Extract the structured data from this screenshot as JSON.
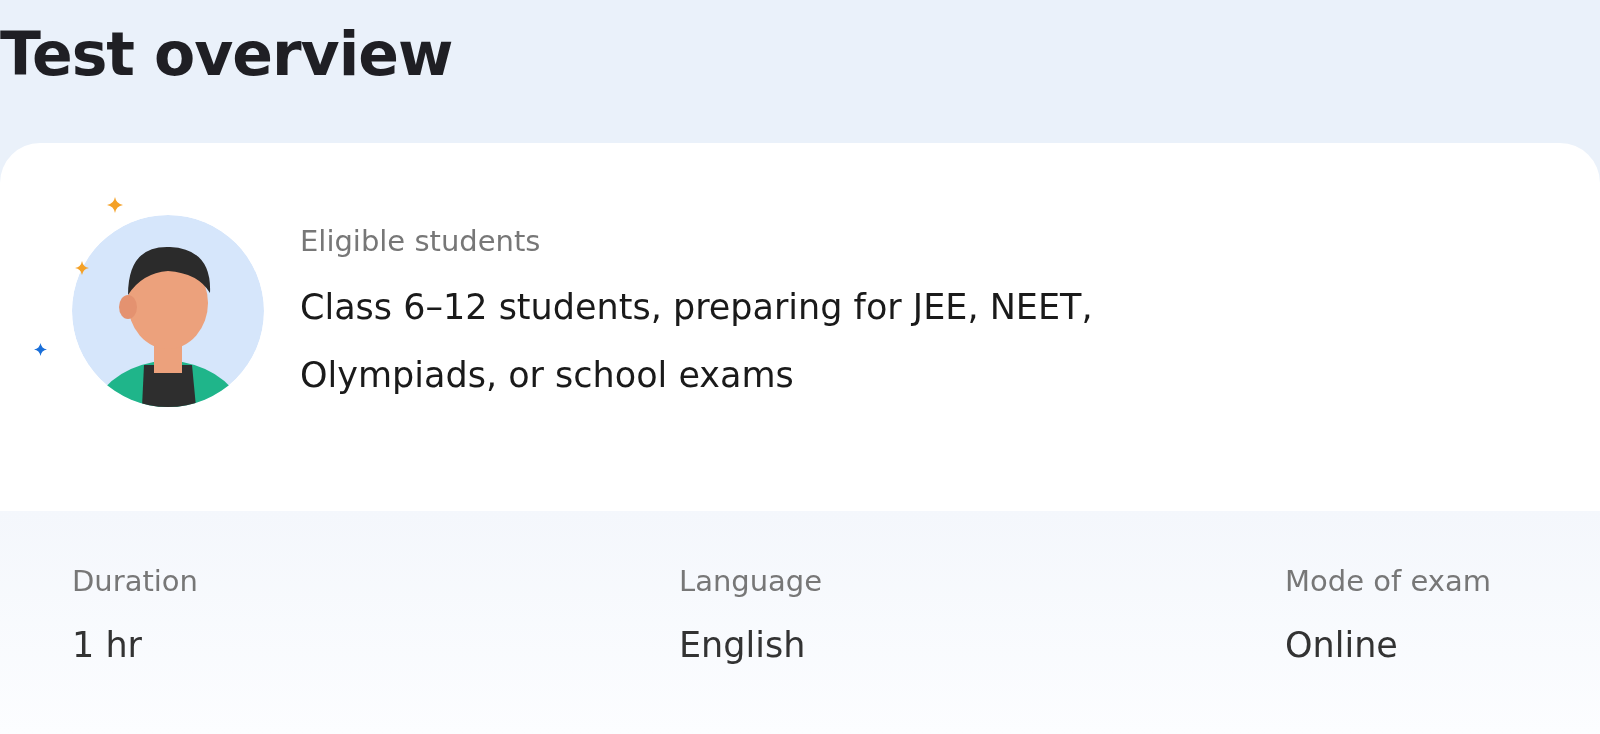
{
  "title": "Test overview",
  "eligibility": {
    "label": "Eligible students",
    "value": "Class 6–12 students, preparing for JEE, NEET, Olympiads, or school exams"
  },
  "details": [
    {
      "label": "Duration",
      "value": "1 hr"
    },
    {
      "label": "Language",
      "value": "English"
    },
    {
      "label": "Mode of exam",
      "value": "Online"
    }
  ]
}
